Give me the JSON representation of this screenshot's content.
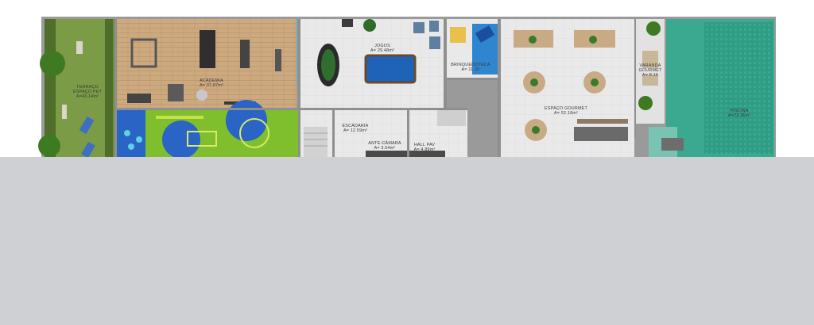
{
  "rooms": {
    "terraco": {
      "name_1": "TERRAÇO",
      "name_2": "ESPAÇO PET",
      "area": "A=43.14m²"
    },
    "academia": {
      "name": "ACADEMIA",
      "area": "A= 37.87m²"
    },
    "jogos": {
      "name": "JOGOS",
      "area": "A= 29.48m²"
    },
    "brinquedoteca": {
      "name": "BRINQUEDOTECA",
      "area": "A= 11.20"
    },
    "espaco_gourmet": {
      "name": "ESPAÇO GOURMET",
      "area": "A= 52.18m²"
    },
    "varanda_gourmet": {
      "name_1": "VARANDA",
      "name_2": "GOURMET",
      "area": "A= 8.16"
    },
    "piscina": {
      "name": "PISCINA",
      "area": "A=23.36m²"
    },
    "escadaria": {
      "name": "ESCADARIA",
      "area": "A= 12.59m²"
    },
    "ante_camara": {
      "name": "ANTE-CÂMARA",
      "area": "A= 3.54m²"
    },
    "hall_pav": {
      "name": "HALL PAV",
      "area": "A= 4.89m²"
    }
  },
  "colors": {
    "lawn": "#6f8f3c",
    "wood_floor": "#caa983",
    "tile_floor": "#e7e7e7",
    "wall": "#8f8f8f",
    "pool_water": "#2f9c84",
    "play_green": "#7fbf2e",
    "play_blue": "#2a64c4",
    "billiard_cloth": "#1f63b8",
    "background_band": "#cfd0d4"
  }
}
